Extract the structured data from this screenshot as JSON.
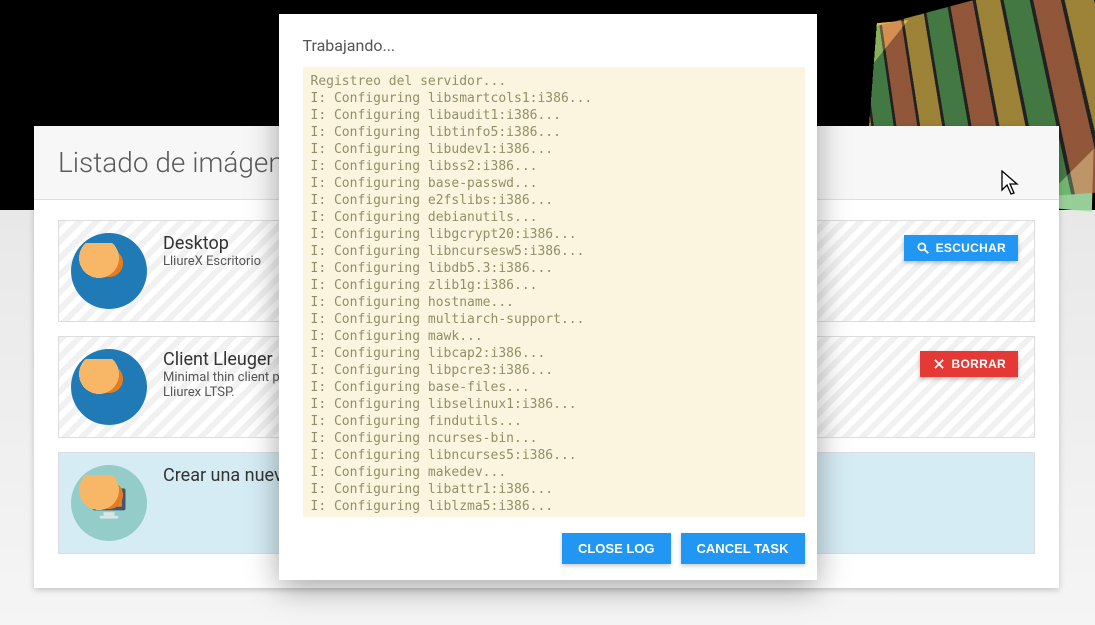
{
  "panel": {
    "title": "Listado de imágenes"
  },
  "cards": [
    {
      "title": "Desktop",
      "desc": "LliureX Escritorio",
      "btn": "ESCUCHAR",
      "btnColor": "blue",
      "avatar": "mascot"
    },
    {
      "title": "Client Lleuger",
      "desc": "Minimal thin client para\nLliurex LTSP.",
      "btn": "BORRAR",
      "btnColor": "red",
      "avatar": "mascot"
    },
    {
      "title": "Crear una nueva",
      "desc": "",
      "btn": "",
      "avatar": "pc",
      "newRow": true
    }
  ],
  "modal": {
    "title": "Trabajando...",
    "closeLog": "CLOSE LOG",
    "cancelTask": "CANCEL TASK",
    "log": "Registreo del servidor...\nI: Configuring libsmartcols1:i386...\nI: Configuring libaudit1:i386...\nI: Configuring libtinfo5:i386...\nI: Configuring libudev1:i386...\nI: Configuring libss2:i386...\nI: Configuring base-passwd...\nI: Configuring e2fslibs:i386...\nI: Configuring debianutils...\nI: Configuring libgcrypt20:i386...\nI: Configuring libncursesw5:i386...\nI: Configuring libdb5.3:i386...\nI: Configuring zlib1g:i386...\nI: Configuring hostname...\nI: Configuring multiarch-support...\nI: Configuring mawk...\nI: Configuring libcap2:i386...\nI: Configuring libpcre3:i386...\nI: Configuring base-files...\nI: Configuring libselinux1:i386...\nI: Configuring findutils...\nI: Configuring ncurses-bin...\nI: Configuring libncurses5:i386...\nI: Configuring makedev...\nI: Configuring libattr1:i386...\nI: Configuring liblzma5:i386...\n"
  }
}
